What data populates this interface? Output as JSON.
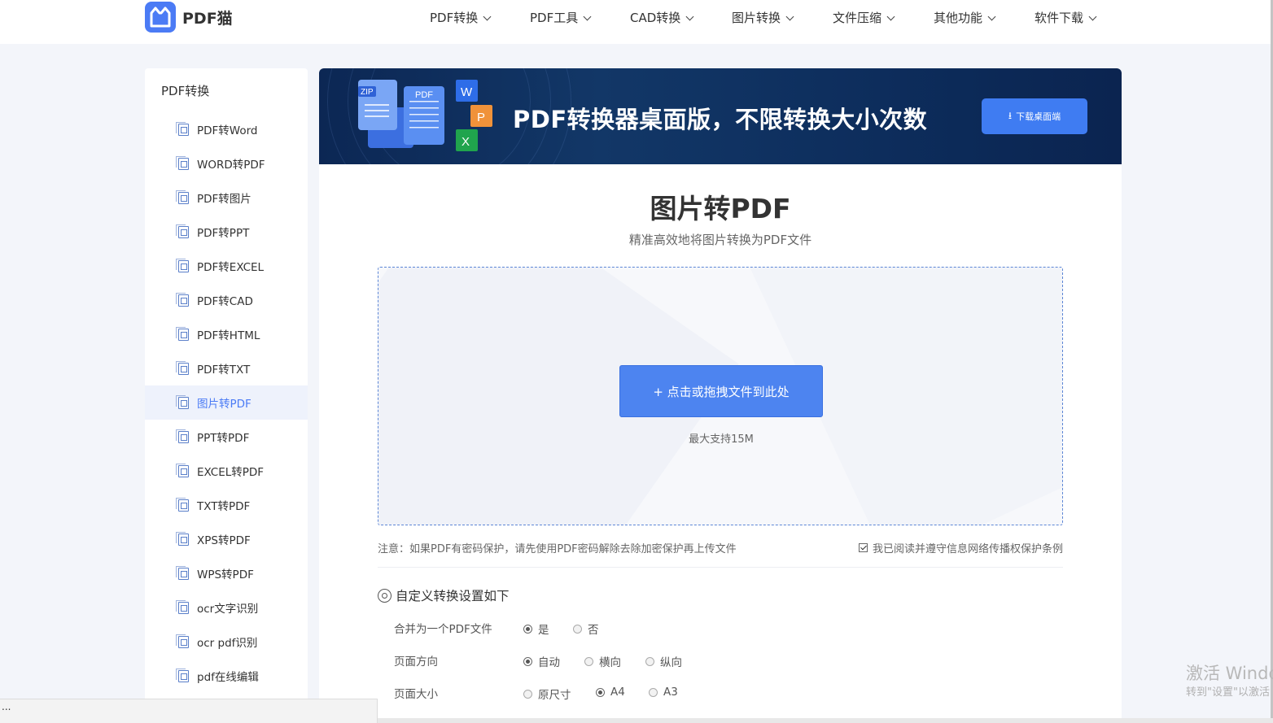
{
  "header": {
    "brand": "PDF猫",
    "nav": [
      {
        "label": "PDF转换"
      },
      {
        "label": "PDF工具"
      },
      {
        "label": "CAD转换"
      },
      {
        "label": "图片转换"
      },
      {
        "label": "文件压缩"
      },
      {
        "label": "其他功能"
      },
      {
        "label": "软件下载"
      }
    ]
  },
  "sidebar": {
    "title": "PDF转换",
    "items": [
      {
        "label": "PDF转Word"
      },
      {
        "label": "WORD转PDF"
      },
      {
        "label": "PDF转图片"
      },
      {
        "label": "PDF转PPT"
      },
      {
        "label": "PDF转EXCEL"
      },
      {
        "label": "PDF转CAD"
      },
      {
        "label": "PDF转HTML"
      },
      {
        "label": "PDF转TXT"
      },
      {
        "label": "图片转PDF",
        "active": true
      },
      {
        "label": "PPT转PDF"
      },
      {
        "label": "EXCEL转PDF"
      },
      {
        "label": "TXT转PDF"
      },
      {
        "label": "XPS转PDF"
      },
      {
        "label": "WPS转PDF"
      },
      {
        "label": "ocr文字识别"
      },
      {
        "label": "ocr pdf识别"
      },
      {
        "label": "pdf在线编辑"
      }
    ]
  },
  "banner": {
    "zip_tag": "ZIP",
    "pdf_tag": "PDF",
    "w_tag": "W",
    "p_tag": "P",
    "x_tag": "X",
    "title": "PDF转换器桌面版，不限转换大小次数",
    "button_label": "下载桌面端"
  },
  "main": {
    "title": "图片转PDF",
    "subtitle": "精准高效地将图片转换为PDF文件",
    "upload_label": "+ 点击或拖拽文件到此处",
    "upload_hint": "最大支持15M",
    "notice": "注意：如果PDF有密码保护，请先使用PDF密码解除去除加密保护再上传文件",
    "agree_label": "我已阅读并遵守信息网络传播权保护条例",
    "agree_checked": true,
    "settings_title": "自定义转换设置如下",
    "options": [
      {
        "label": "合并为一个PDF文件",
        "choices": [
          {
            "label": "是",
            "selected": true
          },
          {
            "label": "否",
            "selected": false
          }
        ]
      },
      {
        "label": "页面方向",
        "choices": [
          {
            "label": "自动",
            "selected": true
          },
          {
            "label": "横向",
            "selected": false
          },
          {
            "label": "纵向",
            "selected": false
          }
        ]
      },
      {
        "label": "页面大小",
        "choices": [
          {
            "label": "原尺寸",
            "selected": false
          },
          {
            "label": "A4",
            "selected": true
          },
          {
            "label": "A3",
            "selected": false
          }
        ]
      }
    ]
  },
  "status": {
    "text": "..."
  },
  "watermark": {
    "line1": "激活 Windo",
    "line2": "转到\"设置\"以激活"
  },
  "colors": {
    "accent": "#4b7bf5",
    "banner_bg": "#0c2754",
    "banner_button": "#3f7cf2"
  }
}
